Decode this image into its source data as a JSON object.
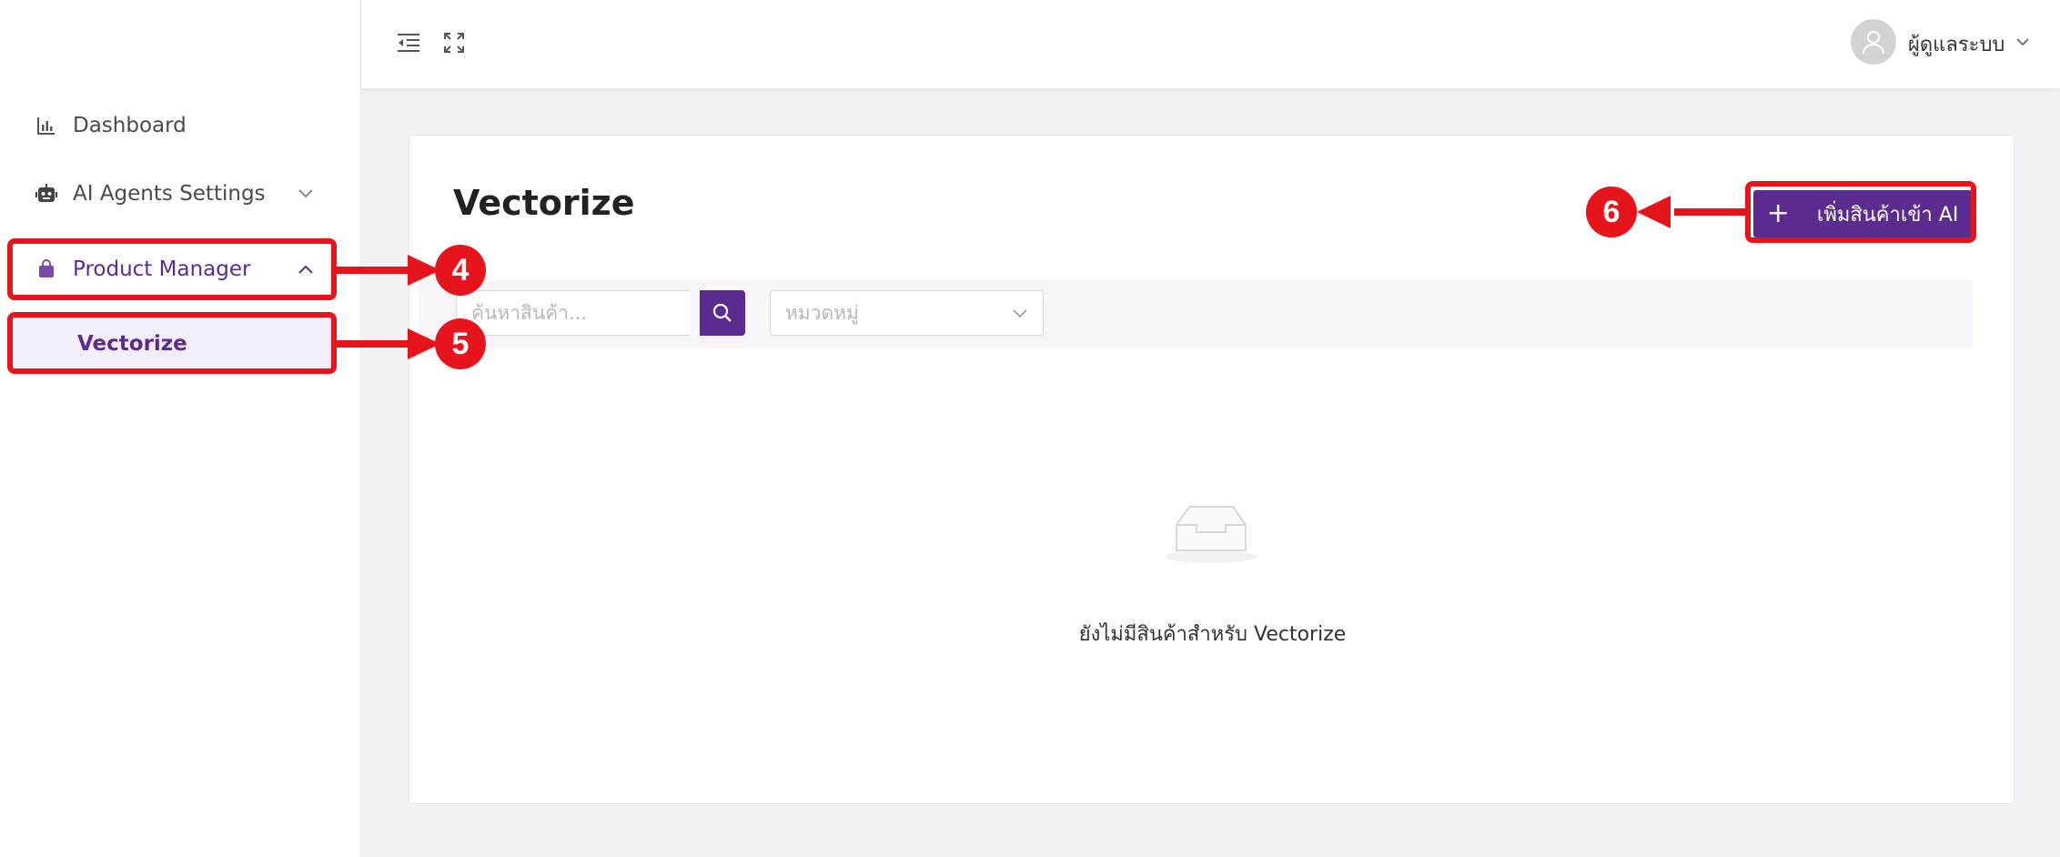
{
  "sidebar": {
    "items": [
      {
        "label": "Dashboard",
        "icon": "bar-chart-icon"
      },
      {
        "label": "AI Agents Settings",
        "icon": "robot-icon"
      },
      {
        "label": "Product Manager",
        "icon": "shopping-bag-icon"
      }
    ],
    "subitems": [
      {
        "label": "Vectorize"
      }
    ]
  },
  "header": {
    "user_name": "ผู้ดูแลระบบ"
  },
  "main": {
    "title": "Vectorize",
    "add_button_label": "เพิ่มสินค้าเข้า AI",
    "search_placeholder": "ค้นหาสินค้า...",
    "category_placeholder": "หมวดหมู่",
    "empty_text": "ยังไม่มีสินค้าสำหรับ Vectorize"
  },
  "callouts": {
    "c4": "4",
    "c5": "5",
    "c6": "6"
  },
  "colors": {
    "primary": "#5b2c8f",
    "annotation_red": "#e8141c"
  }
}
